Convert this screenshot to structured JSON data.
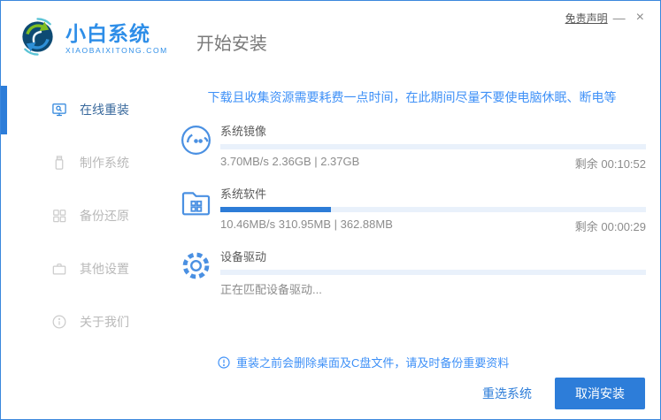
{
  "titlebar": {
    "disclaimer_label": "免责声明",
    "minimize_glyph": "—",
    "close_glyph": "×"
  },
  "brand": {
    "name": "小白系统",
    "site": "XIAOBAIXITONG.COM"
  },
  "header": {
    "page_title": "开始安装"
  },
  "sidebar": {
    "items": [
      {
        "label": "在线重装",
        "icon": "monitor-search-icon",
        "active": true
      },
      {
        "label": "制作系统",
        "icon": "usb-drive-icon",
        "active": false
      },
      {
        "label": "备份还原",
        "icon": "backup-grid-icon",
        "active": false
      },
      {
        "label": "其他设置",
        "icon": "briefcase-icon",
        "active": false
      },
      {
        "label": "关于我们",
        "icon": "info-circle-icon",
        "active": false
      }
    ]
  },
  "main": {
    "notice": "下载且收集资源需要耗费一点时间，在此期间尽量不要使电脑休眠、断电等",
    "tasks": [
      {
        "name": "系统镜像",
        "detail": "3.70MB/s 2.36GB | 2.37GB",
        "remaining": "剩余 00:10:52",
        "progress_width": "0%"
      },
      {
        "name": "系统软件",
        "detail": "10.46MB/s 310.95MB | 362.88MB",
        "remaining": "剩余 00:00:29",
        "progress_width": "26%"
      },
      {
        "name": "设备驱动",
        "detail": "正在匹配设备驱动...",
        "remaining": "",
        "progress_width": "0%"
      }
    ],
    "warning": "重装之前会删除桌面及C盘文件，请及时备份重要资料"
  },
  "footer": {
    "reselect_label": "重选系统",
    "cancel_label": "取消安装"
  },
  "colors": {
    "accent": "#2d8cf0",
    "progress_fill": "#2d7cd7",
    "progress_track": "#e9f1fb",
    "notice_text": "#3e90f7",
    "window_border": "#3a87dd"
  }
}
